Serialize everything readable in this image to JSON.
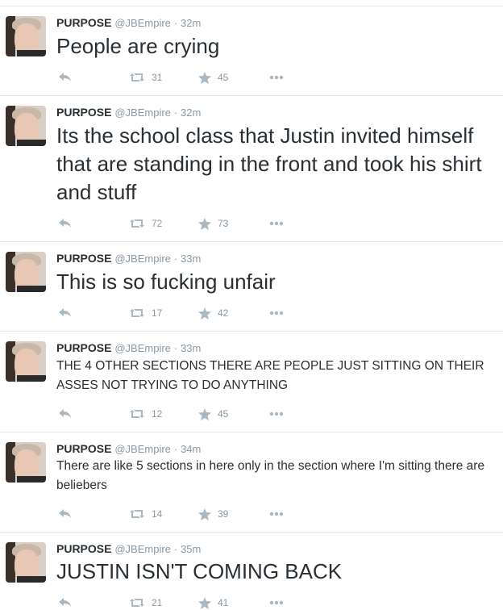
{
  "tweets": [
    {
      "name": "PURPOSE",
      "handle": "@JBEmpire",
      "sep": "·",
      "time": "32m",
      "text": "People are crying",
      "retweets": "31",
      "favorites": "45"
    },
    {
      "name": "PURPOSE",
      "handle": "@JBEmpire",
      "sep": "·",
      "time": "32m",
      "text": "Its the school class that Justin invited himself that are standing in the front and took his shirt and stuff",
      "retweets": "72",
      "favorites": "73"
    },
    {
      "name": "PURPOSE",
      "handle": "@JBEmpire",
      "sep": "·",
      "time": "33m",
      "text": "This is so fucking unfair",
      "retweets": "17",
      "favorites": "42"
    },
    {
      "name": "PURPOSE",
      "handle": "@JBEmpire",
      "sep": "·",
      "time": "33m",
      "text": "THE 4 OTHER SECTIONS THERE ARE PEOPLE JUST SITTING ON THEIR ASSES NOT TRYING TO DO ANYTHING",
      "retweets": "12",
      "favorites": "45"
    },
    {
      "name": "PURPOSE",
      "handle": "@JBEmpire",
      "sep": "·",
      "time": "34m",
      "text": "There are like 5 sections in here only in the section where I'm sitting there are beliebers",
      "retweets": "14",
      "favorites": "39"
    },
    {
      "name": "PURPOSE",
      "handle": "@JBEmpire",
      "sep": "·",
      "time": "35m",
      "text": "JUSTIN ISN'T COMING BACK",
      "retweets": "21",
      "favorites": "41"
    }
  ],
  "icons": {
    "reply": "reply-icon",
    "retweet": "retweet-icon",
    "favorite": "star-icon",
    "more": "more-dots-icon"
  },
  "colors": {
    "icon": "#aab8c2",
    "meta": "#8899a6",
    "text": "#292f33",
    "divider": "#e1e8ed"
  }
}
